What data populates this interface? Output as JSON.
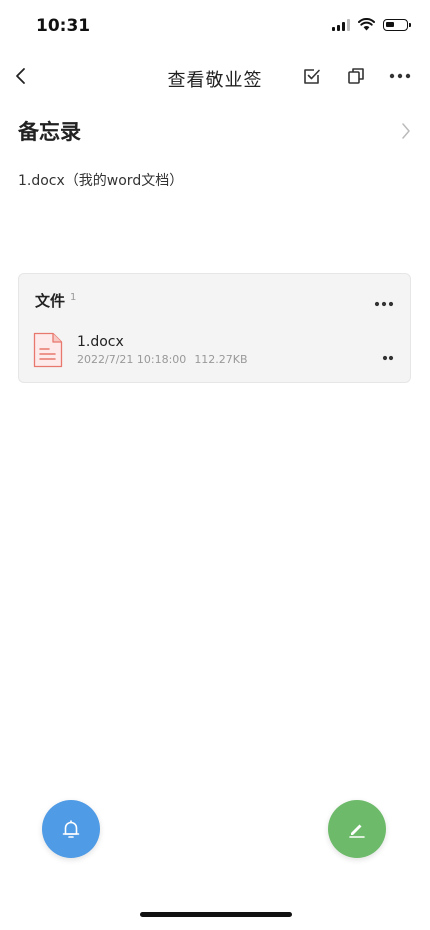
{
  "status_bar": {
    "time": "10:31",
    "icons": [
      "signal-icon",
      "wifi-icon",
      "battery-icon"
    ]
  },
  "nav": {
    "title": "查看敬业签",
    "icons": [
      "back-icon",
      "checkbox-icon",
      "copy-icon",
      "more-icon"
    ]
  },
  "memo": {
    "title": "备忘录",
    "content": "1.docx（我的word文档）"
  },
  "files": {
    "title": "文件",
    "count": "1",
    "items": [
      {
        "name": "1.docx",
        "date": "2022/7/21 10:18:00",
        "size": "112.27KB",
        "icon": "document-icon"
      }
    ]
  },
  "fabs": {
    "reminder_icon": "bell-icon",
    "edit_icon": "pencil-icon"
  },
  "colors": {
    "reminder_fab": "#4f9be6",
    "edit_fab": "#6dbb6a",
    "file_icon": "#e8786e",
    "card_bg": "#f4f4f4"
  }
}
